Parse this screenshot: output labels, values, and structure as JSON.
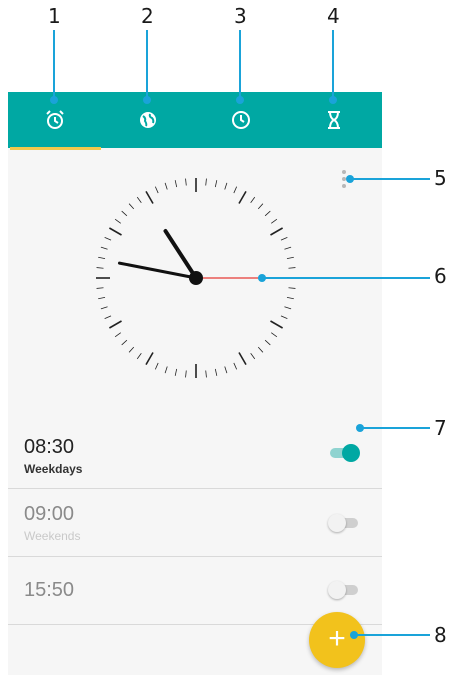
{
  "callouts": [
    "1",
    "2",
    "3",
    "4",
    "5",
    "6",
    "7",
    "8"
  ],
  "tabs": [
    {
      "icon": "alarm-clock-icon"
    },
    {
      "icon": "world-clock-icon"
    },
    {
      "icon": "clock-icon"
    },
    {
      "icon": "timer-icon"
    }
  ],
  "clock": {
    "hour_hand_deg": -33,
    "minute_hand_deg": -79,
    "second_hand_deg": 90
  },
  "alarms": [
    {
      "time": "08:30",
      "days": "Weekdays",
      "enabled": true
    },
    {
      "time": "09:00",
      "days": "Weekends",
      "enabled": false
    },
    {
      "time": "15:50",
      "days": "",
      "enabled": false
    }
  ],
  "fab": {
    "label": "+"
  },
  "colors": {
    "accent": "#00a8a3",
    "fab": "#f2c21c",
    "callout": "#1aa3d9"
  }
}
